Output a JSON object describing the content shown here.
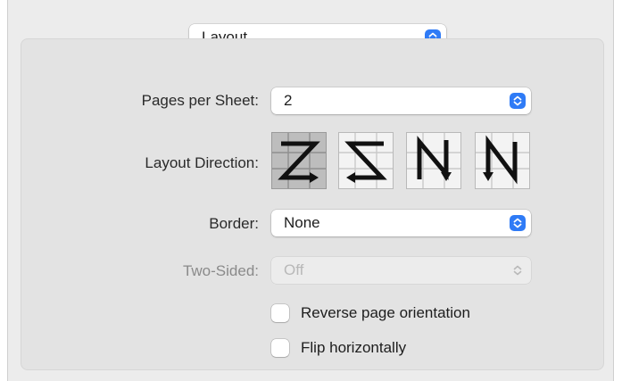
{
  "section_popup": {
    "value": "Layout"
  },
  "pages_per_sheet": {
    "label": "Pages per Sheet:",
    "value": "2"
  },
  "layout_direction": {
    "label": "Layout Direction:",
    "options": [
      {
        "icon": "z-left-to-right-icon",
        "selected": true
      },
      {
        "icon": "z-right-to-left-icon",
        "selected": false
      },
      {
        "icon": "n-top-to-bottom-reverse-icon",
        "selected": false
      },
      {
        "icon": "n-top-to-bottom-icon",
        "selected": false
      }
    ]
  },
  "border": {
    "label": "Border:",
    "value": "None"
  },
  "two_sided": {
    "label": "Two-Sided:",
    "value": "Off",
    "enabled": false
  },
  "reverse_orientation": {
    "label": "Reverse page orientation",
    "checked": false
  },
  "flip_horizontally": {
    "label": "Flip horizontally",
    "checked": false
  },
  "colors": {
    "accent": "#2f7bf6",
    "selected_button": "#bdbdbd"
  }
}
